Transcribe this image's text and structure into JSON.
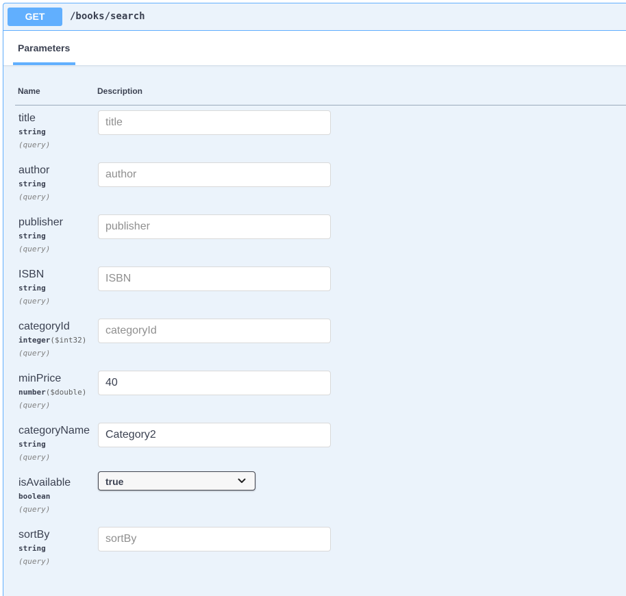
{
  "operation": {
    "method": "GET",
    "path": "/books/search"
  },
  "section": {
    "tab_label": "Parameters"
  },
  "columns": {
    "name": "Name",
    "description": "Description"
  },
  "parameters": [
    {
      "name": "title",
      "type": "string",
      "format": "",
      "in": "(query)",
      "placeholder": "title",
      "value": ""
    },
    {
      "name": "author",
      "type": "string",
      "format": "",
      "in": "(query)",
      "placeholder": "author",
      "value": ""
    },
    {
      "name": "publisher",
      "type": "string",
      "format": "",
      "in": "(query)",
      "placeholder": "publisher",
      "value": ""
    },
    {
      "name": "ISBN",
      "type": "string",
      "format": "",
      "in": "(query)",
      "placeholder": "ISBN",
      "value": ""
    },
    {
      "name": "categoryId",
      "type": "integer",
      "format": "($int32)",
      "in": "(query)",
      "placeholder": "categoryId",
      "value": ""
    },
    {
      "name": "minPrice",
      "type": "number",
      "format": "($double)",
      "in": "(query)",
      "placeholder": "",
      "value": "40"
    },
    {
      "name": "categoryName",
      "type": "string",
      "format": "",
      "in": "(query)",
      "placeholder": "",
      "value": "Category2"
    },
    {
      "name": "isAvailable",
      "type": "boolean",
      "format": "",
      "in": "(query)",
      "selected": "true"
    },
    {
      "name": "sortBy",
      "type": "string",
      "format": "",
      "in": "(query)",
      "placeholder": "sortBy",
      "value": ""
    }
  ],
  "icons": {
    "select_arrow": "chevron-down-icon"
  },
  "colors": {
    "get_accent": "#61affe",
    "block_background": "#ebf3fb",
    "text": "#3b4151"
  }
}
